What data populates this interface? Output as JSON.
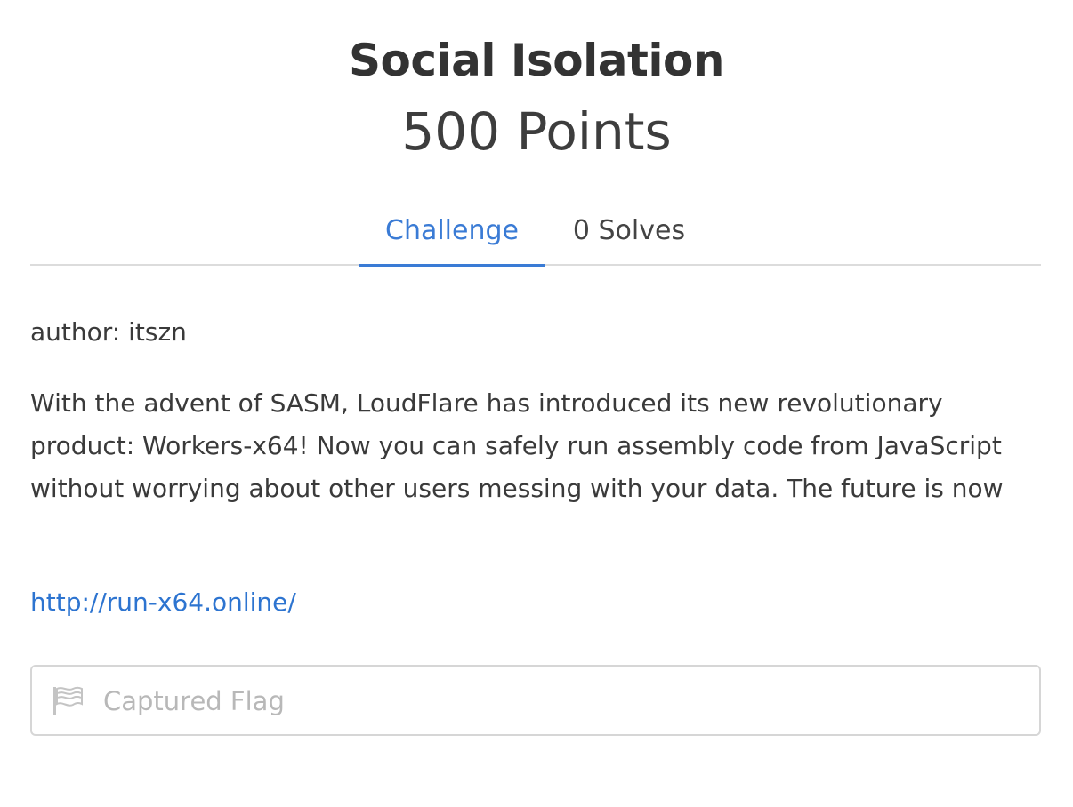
{
  "challenge": {
    "title": "Social Isolation",
    "points": "500 Points"
  },
  "tabs": [
    {
      "label": "Challenge",
      "active": true
    },
    {
      "label": "0 Solves",
      "active": false
    }
  ],
  "content": {
    "author": "author: itszn",
    "description": "With the advent of SASM, LoudFlare has introduced its new revolutionary product: Workers-x64! Now you can safely run assembly code from JavaScript without worrying about other users messing with your data. The future is now",
    "link_text": "http://run-x64.online/"
  },
  "flag_input": {
    "placeholder": "Captured Flag",
    "value": "",
    "icon": "flag-icon"
  },
  "colors": {
    "accent": "#3a7bd5",
    "link": "#2d74d0",
    "text": "#3a3a3a",
    "divider": "#dcdcdc"
  }
}
